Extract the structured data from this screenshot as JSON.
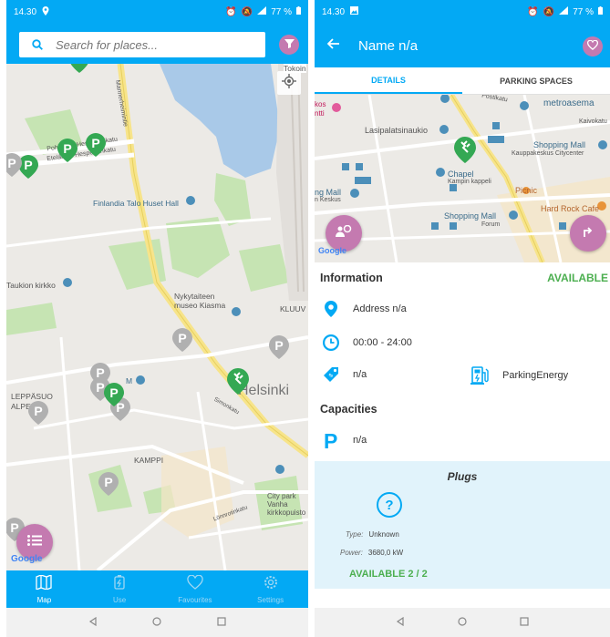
{
  "left": {
    "status": {
      "time": "14.30",
      "battery": "77 %"
    },
    "search": {
      "placeholder": "Search for places..."
    },
    "map_labels": [
      "Tokoin",
      "Pohjoinen Hesperiankatu",
      "Eteläinen Hesperiankatu",
      "Mannerheimintie",
      "Finlandia Talo Huset Hall",
      "Taukion kirkko",
      "Nykytaiteen museo Kiasma",
      "KLUUV",
      "Helsinki",
      "LEPPÄSUO ALPER",
      "KAMPPI",
      "City park Vanha kirkkopuisto",
      "Simonkatu",
      "Lönnrotinkatu",
      "M"
    ],
    "google": "Google",
    "nav": [
      {
        "label": "Map",
        "icon": "map-icon",
        "active": true
      },
      {
        "label": "Use",
        "icon": "charging-icon",
        "active": false
      },
      {
        "label": "Favourites",
        "icon": "heart-icon",
        "active": false
      },
      {
        "label": "Settings",
        "icon": "gear-icon",
        "active": false
      }
    ]
  },
  "right": {
    "status": {
      "time": "14.30",
      "battery": "77 %"
    },
    "app_bar": {
      "title": "Name n/a"
    },
    "tabs": [
      "DETAILS",
      "PARKING SPACES"
    ],
    "map_labels": [
      "Postikatu",
      "metroasema",
      "Kaivokatu",
      "Lasipalatsinaukio",
      "Shopping Mall",
      "Kauppakeskus Citycenter",
      "Chapel",
      "Kampin kappeli",
      "Picnic",
      "ng Mall",
      "n Keskus",
      "Shopping Mall",
      "Forum",
      "Hard Rock Cafe",
      "kos",
      "ntti"
    ],
    "google": "Google",
    "information": {
      "heading": "Information",
      "status": "AVAILABLE",
      "address": "Address n/a",
      "hours": "00:00 - 24:00",
      "price": "n/a",
      "operator": "ParkingEnergy"
    },
    "capacities": {
      "heading": "Capacities",
      "value": "n/a"
    },
    "plugs": {
      "heading": "Plugs",
      "type_label": "Type:",
      "type_value": "Unknown",
      "power_label": "Power:",
      "power_value": "3680,0 kW",
      "available": "AVAILABLE 2 / 2"
    }
  },
  "colors": {
    "primary": "#03a9f4",
    "accent": "#c47ab0",
    "green": "#4caf50",
    "plug_bg": "#e1f3fb"
  }
}
